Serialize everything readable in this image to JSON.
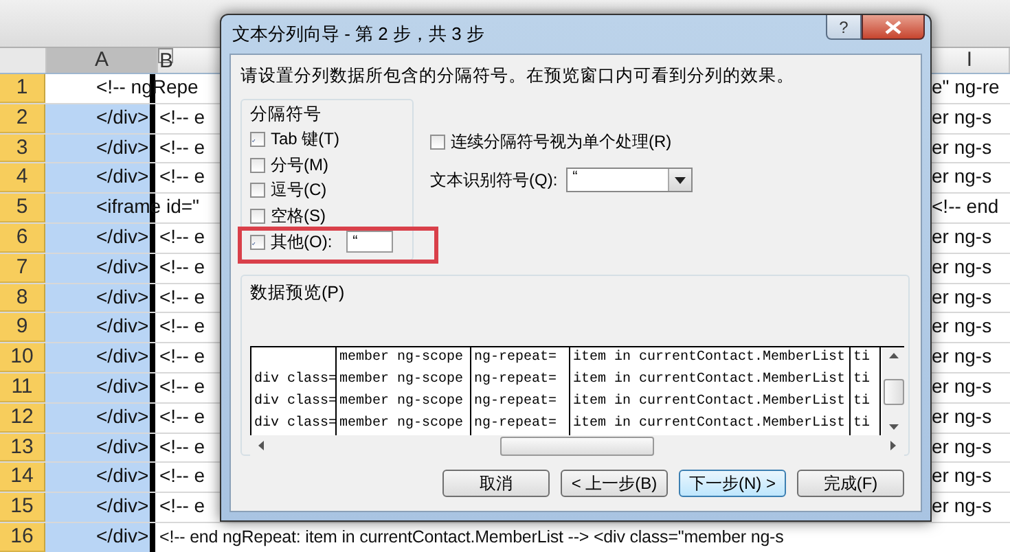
{
  "spreadsheet": {
    "column_headers": [
      {
        "label": "A",
        "selected": true
      },
      {
        "label": "B",
        "selected": false
      },
      {
        "label": "I",
        "selected": false
      }
    ],
    "rows": [
      {
        "number": "1",
        "cell_a": "<!-- ngRepe",
        "active": true,
        "right_text": "e\" ng-re"
      },
      {
        "number": "2",
        "cell_a": "</div>",
        "cell_b": "<!-- e",
        "active": false,
        "right_text": "er ng-s"
      },
      {
        "number": "3",
        "cell_a": "</div>",
        "cell_b": "<!-- e",
        "active": false,
        "right_text": "er ng-s"
      },
      {
        "number": "4",
        "cell_a": "</div>",
        "cell_b": "<!-- e",
        "active": false,
        "right_text": "er ng-s"
      },
      {
        "number": "5",
        "cell_a": "<iframe id=\"",
        "active": false,
        "right_text": "<!-- end"
      },
      {
        "number": "6",
        "cell_a": "</div>",
        "cell_b": "<!-- e",
        "active": false,
        "right_text": "er ng-s"
      },
      {
        "number": "7",
        "cell_a": "</div>",
        "cell_b": "<!-- e",
        "active": false,
        "right_text": "er ng-s"
      },
      {
        "number": "8",
        "cell_a": "</div>",
        "cell_b": "<!-- e",
        "active": false,
        "right_text": "er ng-s"
      },
      {
        "number": "9",
        "cell_a": "</div>",
        "cell_b": "<!-- e",
        "active": false,
        "right_text": "er ng-s"
      },
      {
        "number": "10",
        "cell_a": "</div>",
        "cell_b": "<!-- e",
        "active": false,
        "right_text": "er ng-s"
      },
      {
        "number": "11",
        "cell_a": "</div>",
        "cell_b": "<!-- e",
        "active": false,
        "right_text": "er ng-s"
      },
      {
        "number": "12",
        "cell_a": "</div>",
        "cell_b": "<!-- e",
        "active": false,
        "right_text": "er ng-s"
      },
      {
        "number": "13",
        "cell_a": "</div>",
        "cell_b": "<!-- e",
        "active": false,
        "right_text": "er ng-s"
      },
      {
        "number": "14",
        "cell_a": "</div>",
        "cell_b": "<!-- e",
        "active": false,
        "right_text": "er ng-s"
      },
      {
        "number": "15",
        "cell_a": "</div>",
        "cell_b": "<!-- e",
        "active": false,
        "right_text": "er ng-s"
      },
      {
        "number": "16",
        "cell_a": "</div>",
        "cell_b": "<!-- end ngRepeat: item in currentContact.MemberList --> <div class=\"member ng-s",
        "active": false
      }
    ]
  },
  "dialog": {
    "title": "文本分列向导 - 第 2 步，共 3 步",
    "help_button": "?",
    "instruction": "请设置分列数据所包含的分隔符号。在预览窗口内可看到分列的效果。",
    "delimiters": {
      "title": "分隔符号",
      "items": [
        {
          "kind": "checkbox",
          "label": "Tab 键(T)",
          "checked": true
        },
        {
          "kind": "checkbox",
          "label": "分号(M)",
          "checked": false
        },
        {
          "kind": "checkbox",
          "label": "逗号(C)",
          "checked": false
        },
        {
          "kind": "checkbox",
          "label": "空格(S)",
          "checked": false
        },
        {
          "kind": "checkbox-input",
          "label": "其他(O):",
          "checked": true,
          "value": "“",
          "highlighted": true
        }
      ]
    },
    "consecutive": {
      "label": "连续分隔符号视为单个处理(R)",
      "checked": false
    },
    "qualifier": {
      "label": "文本识别符号(Q):",
      "value": "“"
    },
    "preview": {
      "title": "数据预览(P)",
      "rows": [
        [
          "",
          "member ng-scope",
          "ng-repeat=",
          "item in currentContact.MemberList",
          "ti"
        ],
        [
          "div class=",
          "member ng-scope",
          "ng-repeat=",
          "item in currentContact.MemberList",
          "ti"
        ],
        [
          "div class=",
          "member ng-scope",
          "ng-repeat=",
          "item in currentContact.MemberList",
          "ti"
        ],
        [
          "div class=",
          "member ng-scope",
          "ng-repeat=",
          "item in currentContact.MemberList",
          "ti"
        ]
      ]
    },
    "buttons": [
      {
        "label": "取消",
        "focused": false
      },
      {
        "label": "< 上一步(B)",
        "focused": false
      },
      {
        "label": "下一步(N) >",
        "focused": true
      },
      {
        "label": "完成(F)",
        "focused": false
      }
    ]
  }
}
